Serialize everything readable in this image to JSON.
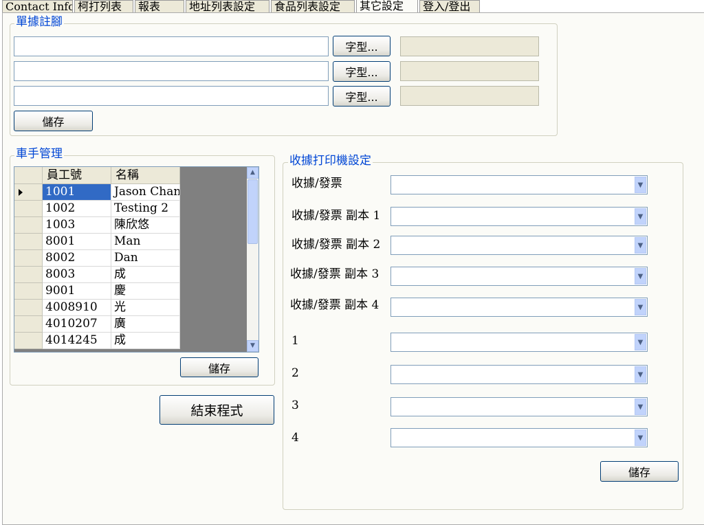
{
  "tabs": [
    {
      "label": "Contact Info"
    },
    {
      "label": "柯打列表"
    },
    {
      "label": "報表"
    },
    {
      "label": "地址列表設定"
    },
    {
      "label": "食品列表設定"
    },
    {
      "label": "其它設定"
    },
    {
      "label": "登入/登出"
    }
  ],
  "footer_group": {
    "legend": "單據註腳",
    "rows": [
      {
        "text": "",
        "font_label": "字型..."
      },
      {
        "text": "",
        "font_label": "字型..."
      },
      {
        "text": "",
        "font_label": "字型..."
      }
    ],
    "save_label": "儲存"
  },
  "driver_group": {
    "legend": "車手管理",
    "columns": [
      "員工號",
      "名稱"
    ],
    "rows": [
      {
        "id": "1001",
        "name": "Jason Chan"
      },
      {
        "id": "1002",
        "name": "Testing 2"
      },
      {
        "id": "1003",
        "name": "陳欣悠"
      },
      {
        "id": "8001",
        "name": "Man"
      },
      {
        "id": "8002",
        "name": "Dan"
      },
      {
        "id": "8003",
        "name": "成"
      },
      {
        "id": "9001",
        "name": "慶"
      },
      {
        "id": "4008910",
        "name": "光"
      },
      {
        "id": "4010207",
        "name": "廣"
      },
      {
        "id": "4014245",
        "name": "成"
      }
    ],
    "save_label": "儲存"
  },
  "exit_label": "結束程式",
  "printer_group": {
    "legend": "收據打印機設定",
    "rows": [
      {
        "label": "收據/發票",
        "value": ""
      },
      {
        "label": "收據/發票 副本 1",
        "value": ""
      },
      {
        "label": "收據/發票 副本 2",
        "value": ""
      },
      {
        "label": "收據/發票 副本 3",
        "value": ""
      },
      {
        "label": "收據/發票 副本 4",
        "value": ""
      },
      {
        "label": "1",
        "value": ""
      },
      {
        "label": "2",
        "value": ""
      },
      {
        "label": "3",
        "value": ""
      },
      {
        "label": "4",
        "value": ""
      }
    ],
    "save_label": "儲存"
  },
  "icons": {
    "row_pointer": "row-pointer-icon",
    "scroll_up": "scroll-up-icon",
    "scroll_down": "scroll-down-icon",
    "dropdown": "chevron-down-icon"
  },
  "colors": {
    "legend": "#0046d5",
    "selection": "#316ac5",
    "panel": "#fbfbf7"
  }
}
